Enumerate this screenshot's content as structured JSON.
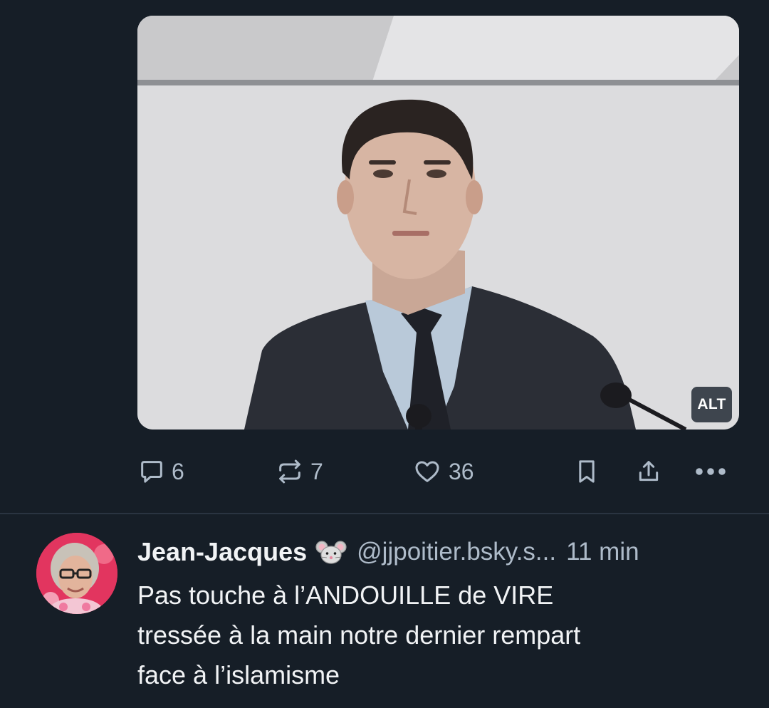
{
  "post": {
    "image": {
      "alt_badge": "ALT"
    },
    "actions": {
      "reply_count": "6",
      "repost_count": "7",
      "like_count": "36"
    }
  },
  "reply": {
    "display_name": "Jean-Jacques",
    "name_emoji": "mouse-face",
    "handle": "@jjpoitier.bsky.s...",
    "time": "11 min",
    "text_lines": [
      "Pas touche à l’ANDOUILLE de VIRE",
      "tressée à la main notre dernier rempart",
      "face à l’islamisme"
    ]
  },
  "colors": {
    "background": "#161e27",
    "primary_text": "#f1f3f5",
    "secondary_text": "#aebbc9",
    "divider": "#2a3441",
    "avatar_bg": "#e2355f"
  }
}
